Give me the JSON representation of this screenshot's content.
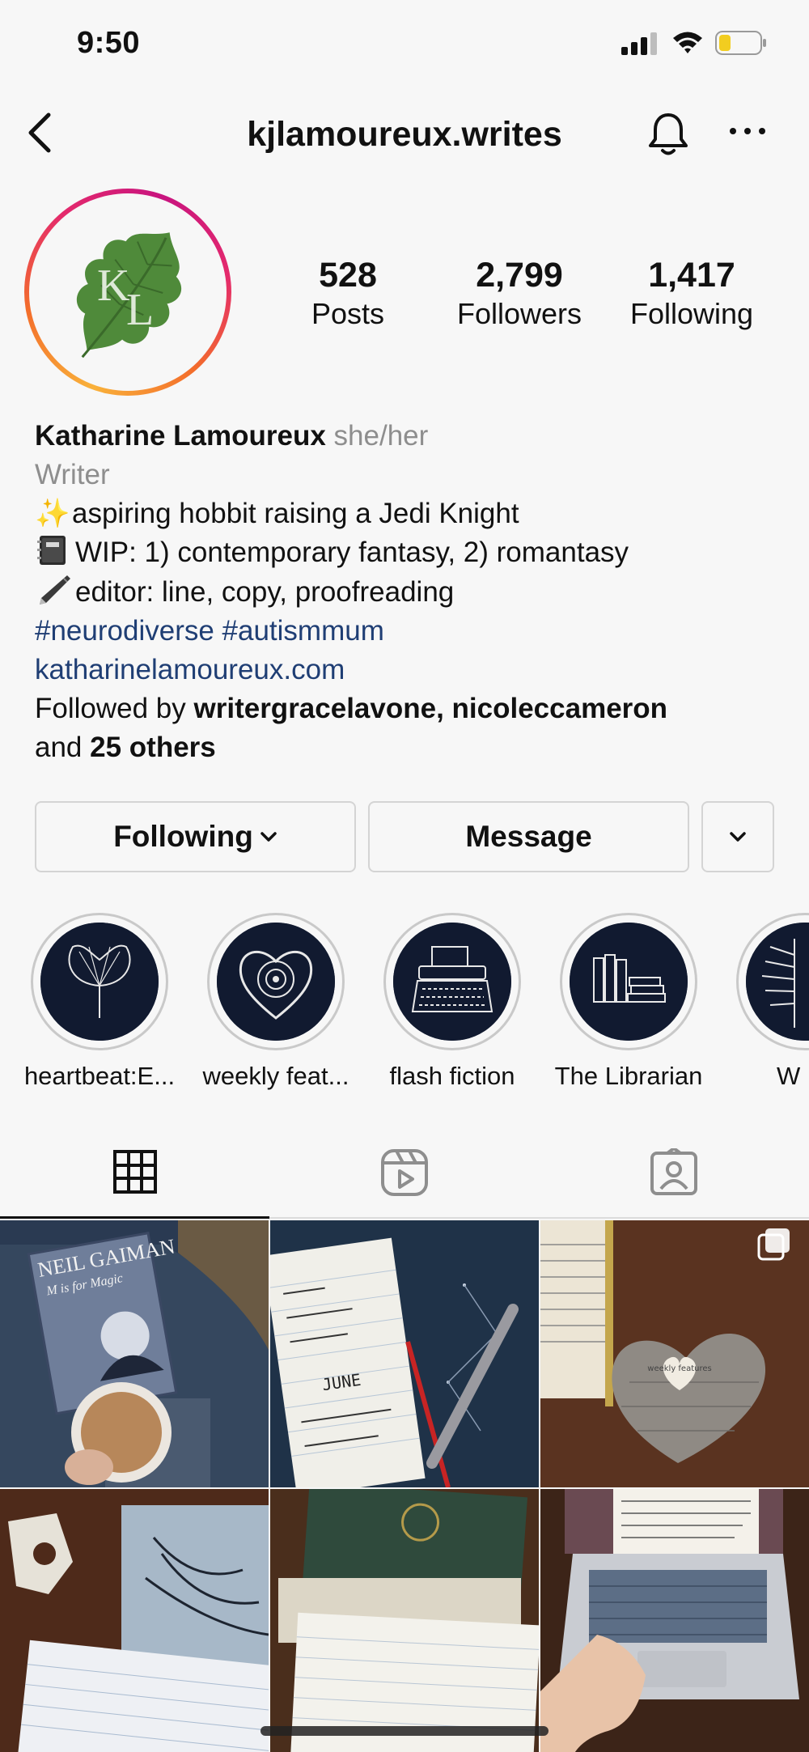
{
  "status_bar": {
    "time": "9:50"
  },
  "nav": {
    "username": "kjlamoureux.writes"
  },
  "stats": [
    {
      "value": "528",
      "label": "Posts"
    },
    {
      "value": "2,799",
      "label": "Followers"
    },
    {
      "value": "1,417",
      "label": "Following"
    }
  ],
  "bio": {
    "name": "Katharine Lamoureux",
    "pronouns": "she/her",
    "category": "Writer",
    "line1": "aspiring hobbit raising a Jedi Knight",
    "line2": "WIP: 1) contemporary fantasy, 2) romantasy",
    "line3": "editor: line, copy, proofreading",
    "hashtags": "#neurodiverse #autismmum",
    "website": "katharinelamoureux.com",
    "followed_by_prefix": "Followed by",
    "followed_by_user1": "writergracelavone,",
    "followed_by_user2": "nicoleccameron",
    "followed_by_and": "and",
    "followed_by_others": "25 others"
  },
  "buttons": {
    "following": "Following",
    "message": "Message"
  },
  "highlights": [
    {
      "label": "heartbeat:E...",
      "icon": "ginkgo-leaf-icon"
    },
    {
      "label": "weekly feat...",
      "icon": "lace-heart-icon"
    },
    {
      "label": "flash fiction",
      "icon": "typewriter-icon"
    },
    {
      "label": "The Librarian",
      "icon": "books-icon"
    },
    {
      "label": "W",
      "icon": "fern-icon"
    }
  ],
  "tabs": [
    {
      "name": "grid",
      "icon": "grid-icon",
      "active": true
    },
    {
      "name": "reels",
      "icon": "reels-icon",
      "active": false
    },
    {
      "name": "tagged",
      "icon": "tagged-icon",
      "active": false
    }
  ],
  "grid_posts": [
    {
      "book_author": "NEIL GAIMAN",
      "book_title": "M is for Magic"
    },
    {
      "note_text": "JUNE"
    },
    {
      "note_text": "weekly features",
      "multi_icon": "carousel-icon"
    },
    {
      "note_text": ""
    },
    {
      "note_text": ""
    },
    {
      "note_text": ""
    }
  ],
  "colors": {
    "link": "#1f3e74",
    "secondary_text": "#8e8e8e",
    "highlight_bg": "#111a30"
  }
}
